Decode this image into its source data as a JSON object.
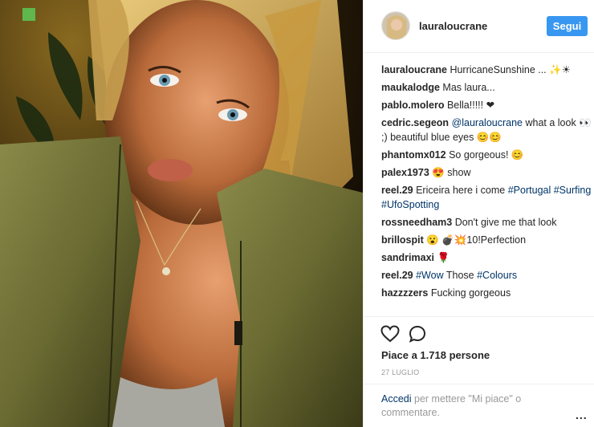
{
  "post": {
    "username": "lauraloucrane",
    "follow_label": "Segui"
  },
  "comments": [
    {
      "user": "lauraloucrane",
      "parts": [
        {
          "text": " HurricaneSunshine ... ✨☀"
        }
      ]
    },
    {
      "user": "maukalodge",
      "parts": [
        {
          "text": " Mas laura..."
        }
      ]
    },
    {
      "user": "pablo.molero",
      "parts": [
        {
          "text": " Bella!!!!! ❤"
        }
      ]
    },
    {
      "user": "cedric.segeon",
      "parts": [
        {
          "text": " "
        },
        {
          "link": "@lauraloucrane"
        },
        {
          "text": " what a look 👀 ;) beautiful blue eyes 😊😊"
        }
      ]
    },
    {
      "user": "phantomx012",
      "parts": [
        {
          "text": " So gorgeous! 😊"
        }
      ]
    },
    {
      "user": "palex1973",
      "parts": [
        {
          "text": " 😍 show"
        }
      ]
    },
    {
      "user": "reel.29",
      "parts": [
        {
          "text": " Ericeira here i come "
        },
        {
          "link": "#Portugal"
        },
        {
          "text": " "
        },
        {
          "link": "#Surfing"
        },
        {
          "text": " "
        },
        {
          "link": "#UfoSpotting"
        }
      ]
    },
    {
      "user": "rossneedham3",
      "parts": [
        {
          "text": " Don't give me that look"
        }
      ]
    },
    {
      "user": "brillospit",
      "parts": [
        {
          "text": " 😮 💣💥10!Perfection"
        }
      ]
    },
    {
      "user": "sandrimaxi",
      "parts": [
        {
          "text": " 🌹"
        }
      ]
    },
    {
      "user": "reel.29",
      "parts": [
        {
          "text": " "
        },
        {
          "link": "#Wow"
        },
        {
          "text": " Those "
        },
        {
          "link": "#Colours"
        }
      ]
    },
    {
      "user": "hazzzzers",
      "parts": [
        {
          "text": " Fucking gorgeous"
        }
      ]
    }
  ],
  "actions": {
    "likes_text": "Piace a 1.718 persone",
    "date": "27 LUGLIO",
    "heart_icon": "heart-icon",
    "comment_icon": "comment-bubble-icon"
  },
  "add_comment": {
    "login_label": "Accedi",
    "rest_text": " per mettere \"Mi piace\" o commentare.",
    "more_label": "..."
  },
  "colors": {
    "follow_button": "#3897f0",
    "link": "#003569"
  }
}
